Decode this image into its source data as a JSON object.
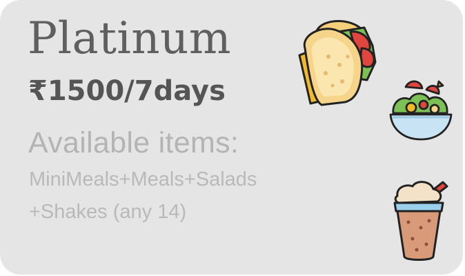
{
  "card": {
    "plan_name": "Platinum",
    "price": "₹1500/7days",
    "available_heading": "Available items:",
    "items_line1": "MiniMeals+Meals+Salads",
    "items_line2": "+Shakes (any 14)"
  },
  "icons": [
    "sandwich-icon",
    "salad-bowl-icon",
    "milkshake-icon"
  ],
  "colors": {
    "card_background": "#e6e5e5",
    "title": "#5f5f5f",
    "price": "#555555",
    "secondary_text": "#b4b4b4"
  }
}
